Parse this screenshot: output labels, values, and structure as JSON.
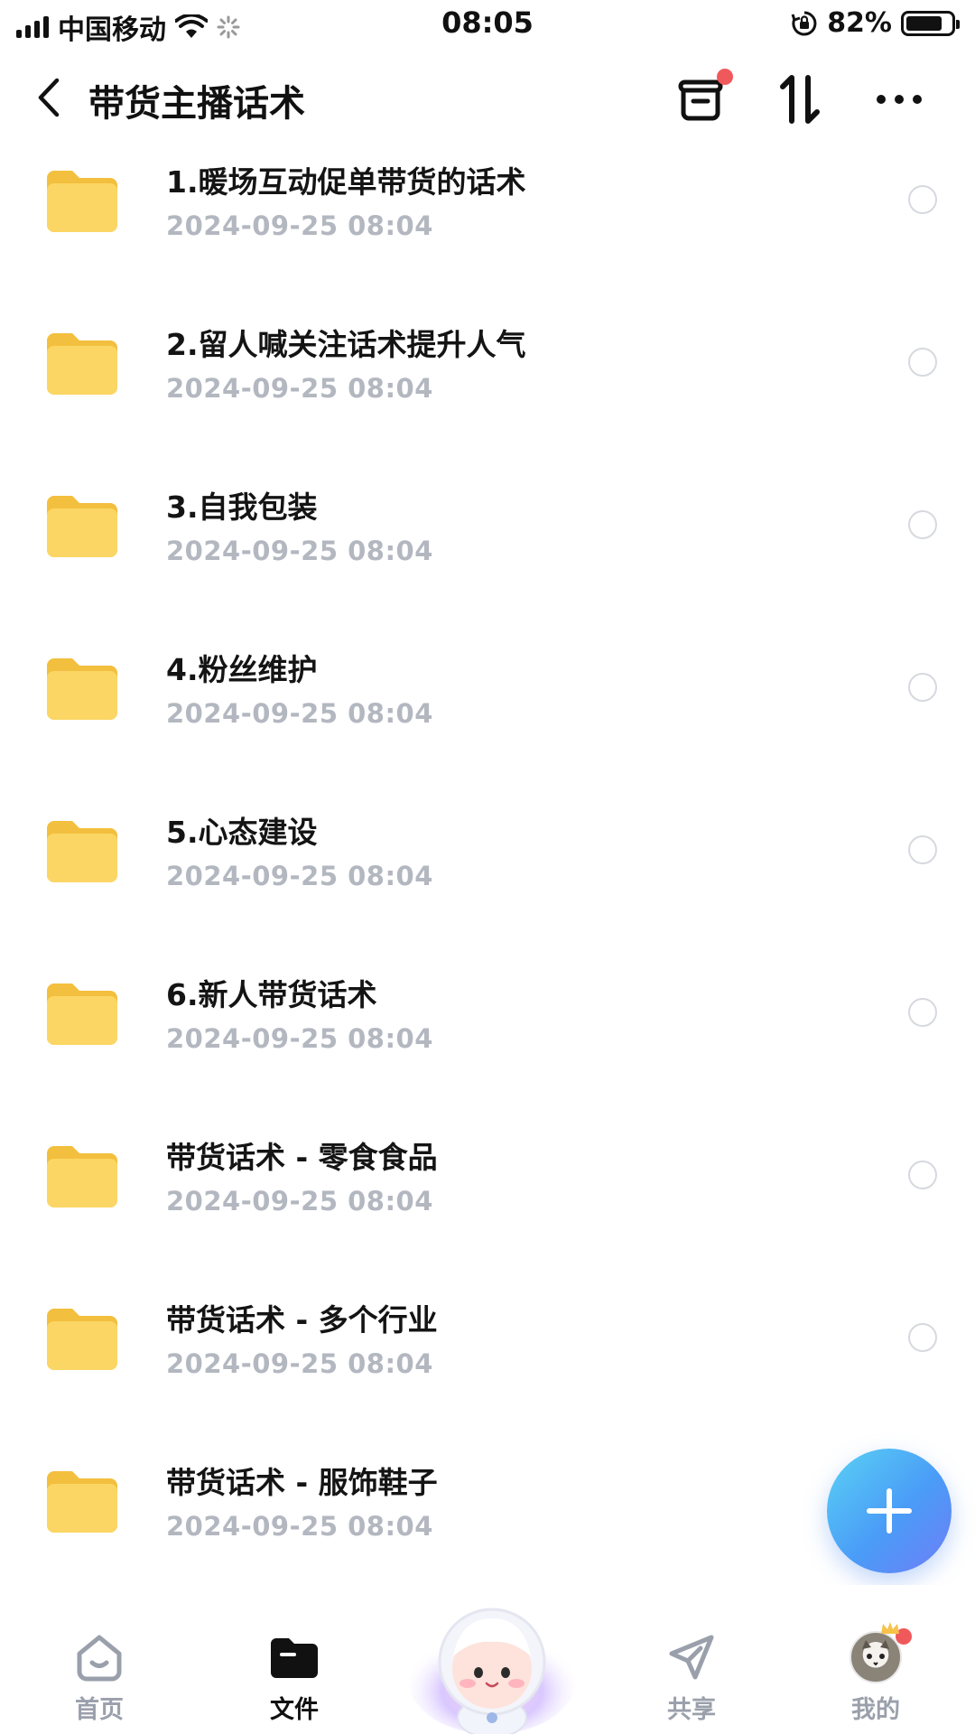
{
  "status_bar": {
    "carrier": "中国移动",
    "time": "08:05",
    "battery": "82%",
    "battery_level": 0.82
  },
  "header": {
    "title": "带货主播话术",
    "back_icon": "chevron-left-icon",
    "actions": [
      "inbox-icon",
      "sort-icon",
      "more-icon"
    ]
  },
  "files": [
    {
      "name": "1.暖场互动促单带货的话术",
      "date": "2024-09-25 08:04"
    },
    {
      "name": "2.留人喊关注话术提升人气",
      "date": "2024-09-25 08:04"
    },
    {
      "name": "3.自我包装",
      "date": "2024-09-25 08:04"
    },
    {
      "name": "4.粉丝维护",
      "date": "2024-09-25 08:04"
    },
    {
      "name": "5.心态建设",
      "date": "2024-09-25 08:04"
    },
    {
      "name": "6.新人带货话术",
      "date": "2024-09-25 08:04"
    },
    {
      "name": "带货话术 - 零食食品",
      "date": "2024-09-25 08:04"
    },
    {
      "name": "带货话术 - 多个行业",
      "date": "2024-09-25 08:04"
    },
    {
      "name": "带货话术 - 服饰鞋子",
      "date": "2024-09-25 08:04"
    }
  ],
  "tabs": [
    {
      "label": "首页",
      "icon": "home-icon"
    },
    {
      "label": "文件",
      "icon": "folder-icon",
      "active": true
    },
    {
      "label": "",
      "icon": "mascot-icon"
    },
    {
      "label": "共享",
      "icon": "send-icon"
    },
    {
      "label": "我的",
      "icon": "avatar-icon"
    }
  ],
  "colors": {
    "folder": "#f7c94a",
    "accent": "#4a9cf7",
    "badge": "#f0595b",
    "muted_text": "#b3b7c0"
  }
}
